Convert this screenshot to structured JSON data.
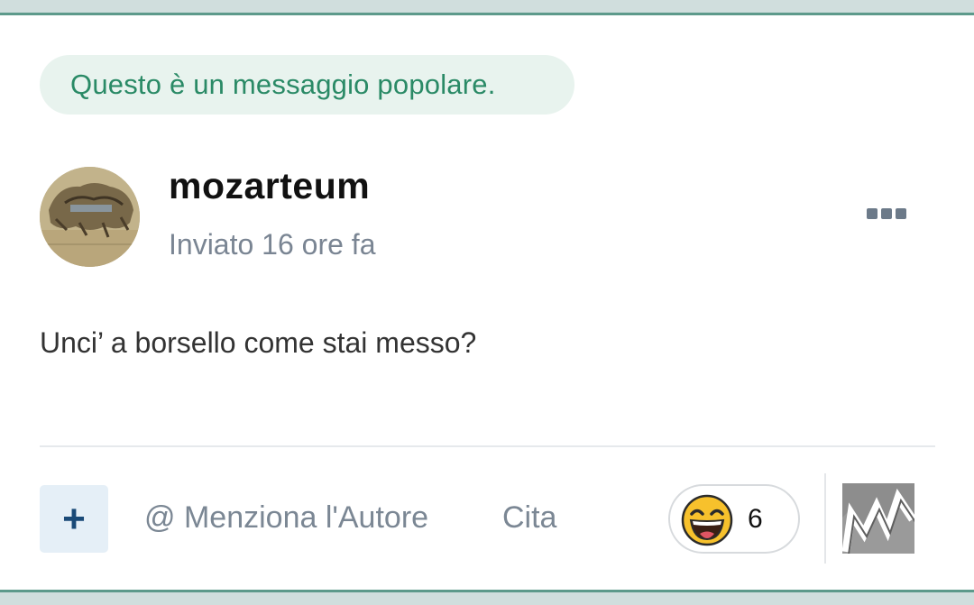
{
  "badge": {
    "text": "Questo è un messaggio popolare."
  },
  "post": {
    "author": "mozarteum",
    "time": "Inviato 16 ore fa",
    "body": "Unci’ a borsello come stai messo?"
  },
  "actions": {
    "plus_label": "+",
    "mention_label": "@ Menziona l'Autore",
    "quote_label": "Cita"
  },
  "reaction": {
    "emoji": "laughing-face",
    "count": "6"
  },
  "icons": {
    "more": "ellipsis-icon",
    "avatar": "avatar-image",
    "reactor": "reactor-avatar-image"
  },
  "colors": {
    "accent_green": "#2a8a66",
    "badge_bg": "#e8f3ee",
    "frame_line": "#5d9a8b",
    "muted_text": "#7b8794",
    "plus_bg": "#e5eff7",
    "plus_fg": "#1a4a78"
  }
}
